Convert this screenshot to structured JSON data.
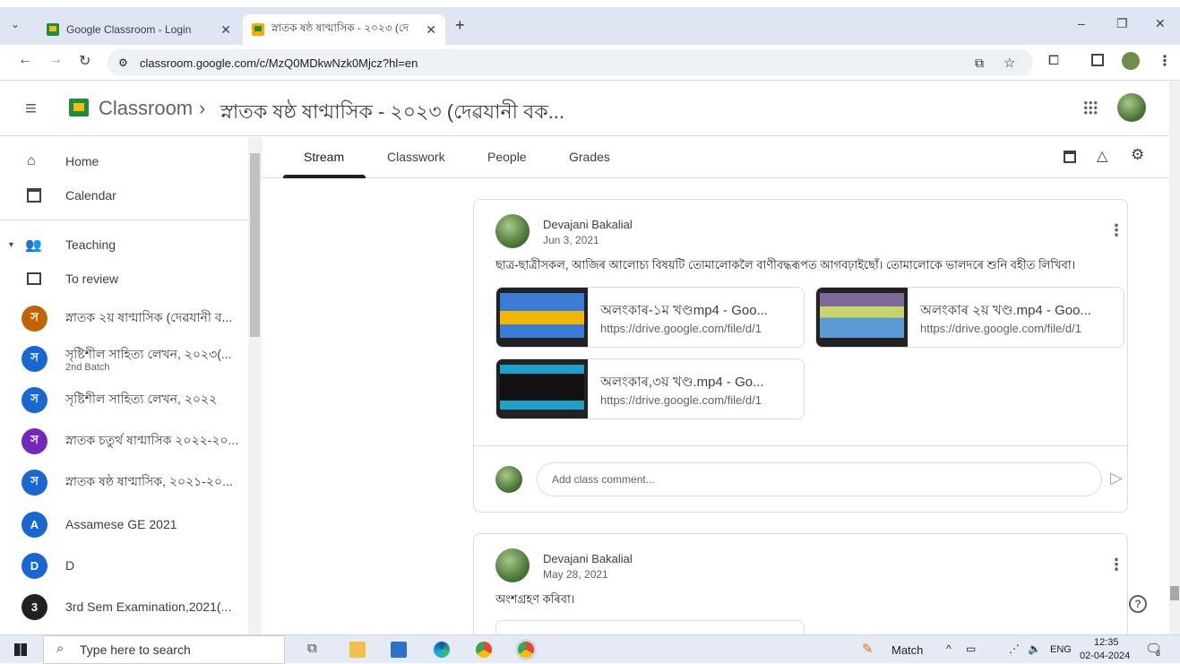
{
  "browser": {
    "tabs": [
      {
        "title": "Google Classroom - Login",
        "active": false
      },
      {
        "title": "স্নাতক ষষ্ঠ ষাণ্মাসিক - ২০২৩ (দে",
        "active": true
      }
    ],
    "url": "classroom.google.com/c/MzQ0MDkwNzk0Mjcz?hl=en",
    "new_tab": "+",
    "minimize": "–",
    "restore": "❐",
    "close": "✕"
  },
  "header": {
    "app_name": "Classroom",
    "separator": "›",
    "class_title": "স্নাতক ষষ্ঠ ষাণ্মাসিক - ২০২৩ (দেৱযানী বক..."
  },
  "sidebar": {
    "items": [
      {
        "label": "Home",
        "icon": "home-icon"
      },
      {
        "label": "Calendar",
        "icon": "calendar-icon"
      },
      {
        "label": "Teaching",
        "icon": "people-icon"
      },
      {
        "label": "To review",
        "icon": "review-icon"
      }
    ],
    "classes": [
      {
        "letter": "স",
        "label": "স্নাতক ২য় ষাণ্মাসিক (দেৱযানী ব...",
        "sub": "",
        "color": "#c26401"
      },
      {
        "letter": "স",
        "label": "সৃষ্টিশীল সাহিত্য লেখন, ২০২৩(...",
        "sub": "2nd Batch",
        "color": "#1967d2"
      },
      {
        "letter": "স",
        "label": "সৃষ্টিশীল সাহিত্য লেখন, ২০২২",
        "sub": "",
        "color": "#1967d2"
      },
      {
        "letter": "স",
        "label": "স্নাতক চতুৰ্থ ষাণ্মাসিক ২০২২-২০...",
        "sub": "",
        "color": "#7627bb"
      },
      {
        "letter": "স",
        "label": "স্নাতক ষষ্ঠ ষাণ্মাসিক, ২০২১-২০...",
        "sub": "",
        "color": "#1967d2"
      },
      {
        "letter": "A",
        "label": "Assamese GE 2021",
        "sub": "",
        "color": "#1967d2"
      },
      {
        "letter": "D",
        "label": "D",
        "sub": "",
        "color": "#1967d2"
      },
      {
        "letter": "3",
        "label": "3rd Sem Examination,2021(...",
        "sub": "",
        "color": "#202124"
      }
    ]
  },
  "class_tabs": [
    "Stream",
    "Classwork",
    "People",
    "Grades"
  ],
  "posts": [
    {
      "author": "Devajani Bakalial",
      "date": "Jun 3, 2021",
      "text": "ছাত্ৰ-ছাত্ৰীসকল, আজিৰ আলোচ্য বিষয়টি তোমালোকলৈ বাণীবদ্ধৰূপত আগবঢ়াইছোঁ। তোমালোকে ভালদৰে শুনি বহীত লিখিবা।",
      "attachments": [
        {
          "title": "অলংকাৰ-১ম খণ্ডmp4 - Goo...",
          "url": "https://drive.google.com/file/d/1"
        },
        {
          "title": "অলংকাৰ ২য় খণ্ড.mp4 - Goo...",
          "url": "https://drive.google.com/file/d/1"
        },
        {
          "title": "অলংকাৰ,৩য় খণ্ড.mp4 - Go...",
          "url": "https://drive.google.com/file/d/1"
        }
      ],
      "comment_placeholder": "Add class comment..."
    },
    {
      "author": "Devajani Bakalial",
      "date": "May 28, 2021",
      "text": "অংশগ্ৰহণ কৰিবা।"
    }
  ],
  "help": "?",
  "taskbar": {
    "search_placeholder": "Type here to search",
    "weather": "Match",
    "lang": "ENG",
    "time": "12:35",
    "date": "02-04-2024",
    "notifications": "3"
  }
}
